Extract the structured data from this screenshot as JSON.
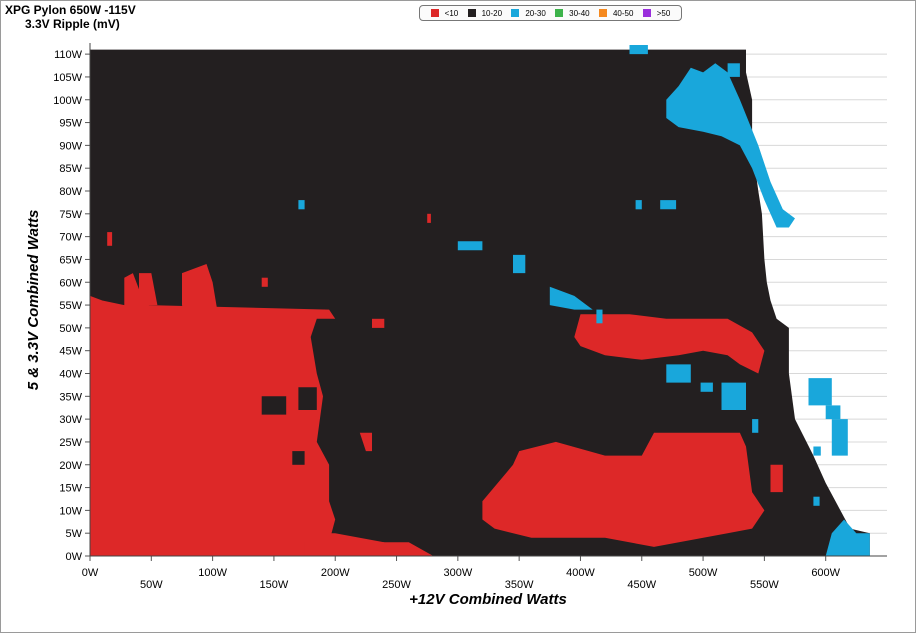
{
  "title": "XPG Pylon 650W -115V",
  "subtitle": "3.3V Ripple (mV)",
  "legend": [
    {
      "label": "<10",
      "color": "#dd2828"
    },
    {
      "label": "10-20",
      "color": "#231f20"
    },
    {
      "label": "20-30",
      "color": "#19a7db"
    },
    {
      "label": "30-40",
      "color": "#3db34a"
    },
    {
      "label": "40-50",
      "color": "#f5891f"
    },
    {
      "label": ">50",
      "color": "#9a2fdc"
    }
  ],
  "chart_data": {
    "type": "heatmap",
    "xlabel": "+12V Combined Watts",
    "ylabel": "5 & 3.3V Combined Watts",
    "x_ticks": [
      "0W",
      "50W",
      "100W",
      "150W",
      "200W",
      "250W",
      "300W",
      "350W",
      "400W",
      "450W",
      "500W",
      "550W",
      "600W"
    ],
    "y_ticks": [
      "0W",
      "5W",
      "10W",
      "15W",
      "20W",
      "25W",
      "30W",
      "35W",
      "40W",
      "45W",
      "50W",
      "55W",
      "60W",
      "65W",
      "70W",
      "75W",
      "80W",
      "85W",
      "90W",
      "95W",
      "100W",
      "105W",
      "110W"
    ],
    "xlim": [
      0,
      650
    ],
    "ylim": [
      0,
      112
    ],
    "grid": true,
    "default_band": "10-20",
    "max_x_boundary": [
      [
        0,
        636
      ],
      [
        5,
        636
      ],
      [
        6,
        620
      ],
      [
        12,
        608
      ],
      [
        16,
        600
      ],
      [
        22,
        590
      ],
      [
        30,
        575
      ],
      [
        40,
        570
      ],
      [
        50,
        570
      ],
      [
        52,
        560
      ],
      [
        56,
        555
      ],
      [
        60,
        552
      ],
      [
        65,
        550
      ],
      [
        75,
        548
      ],
      [
        80,
        545
      ],
      [
        90,
        540
      ],
      [
        100,
        540
      ],
      [
        106,
        535
      ],
      [
        111,
        535
      ]
    ],
    "regions": [
      {
        "band": "<10",
        "points": [
          [
            0,
            0
          ],
          [
            0,
            57
          ],
          [
            10,
            56
          ],
          [
            28,
            55
          ],
          [
            28,
            61
          ],
          [
            35,
            62
          ],
          [
            42,
            57
          ],
          [
            48,
            55
          ],
          [
            195,
            54
          ],
          [
            200,
            52
          ],
          [
            185,
            52
          ],
          [
            180,
            48
          ],
          [
            185,
            40
          ],
          [
            190,
            35
          ],
          [
            185,
            25
          ],
          [
            195,
            20
          ],
          [
            195,
            12
          ],
          [
            200,
            8
          ],
          [
            195,
            3
          ],
          [
            260,
            3
          ],
          [
            280,
            0
          ]
        ]
      },
      {
        "band": "<10",
        "points": [
          [
            40,
            55
          ],
          [
            40,
            62
          ],
          [
            50,
            62
          ],
          [
            55,
            55
          ]
        ]
      },
      {
        "band": "<10",
        "points": [
          [
            75,
            55
          ],
          [
            75,
            62
          ],
          [
            95,
            64
          ],
          [
            100,
            60
          ],
          [
            105,
            52
          ],
          [
            80,
            52
          ]
        ]
      },
      {
        "band": "<10",
        "points": [
          [
            175,
            5
          ],
          [
            200,
            5
          ],
          [
            240,
            3
          ],
          [
            240,
            0
          ],
          [
            175,
            0
          ]
        ]
      },
      {
        "band": "<10",
        "points": [
          [
            320,
            12
          ],
          [
            345,
            20
          ],
          [
            350,
            23
          ],
          [
            380,
            25
          ],
          [
            420,
            22
          ],
          [
            450,
            22
          ],
          [
            460,
            27
          ],
          [
            530,
            27
          ],
          [
            535,
            24
          ],
          [
            540,
            14
          ],
          [
            550,
            10
          ],
          [
            540,
            6
          ],
          [
            520,
            5
          ],
          [
            460,
            2
          ],
          [
            420,
            4
          ],
          [
            360,
            4
          ],
          [
            330,
            6
          ],
          [
            320,
            8
          ]
        ]
      },
      {
        "band": "<10",
        "points": [
          [
            395,
            48
          ],
          [
            400,
            53
          ],
          [
            440,
            53
          ],
          [
            470,
            52
          ],
          [
            520,
            52
          ],
          [
            540,
            49
          ],
          [
            550,
            45
          ],
          [
            545,
            40
          ],
          [
            530,
            42
          ],
          [
            520,
            44
          ],
          [
            500,
            45
          ],
          [
            480,
            44
          ],
          [
            450,
            43
          ],
          [
            420,
            44
          ],
          [
            400,
            46
          ]
        ]
      },
      {
        "band": "<10",
        "points": [
          [
            220,
            27
          ],
          [
            225,
            23
          ],
          [
            230,
            23
          ],
          [
            230,
            27
          ]
        ]
      },
      {
        "band": "<10",
        "points": [
          [
            230,
            52
          ],
          [
            230,
            50
          ],
          [
            240,
            50
          ],
          [
            240,
            52
          ]
        ]
      },
      {
        "band": "<10",
        "points": [
          [
            14,
            68
          ],
          [
            14,
            71
          ],
          [
            18,
            71
          ],
          [
            18,
            68
          ]
        ]
      },
      {
        "band": "<10",
        "points": [
          [
            140,
            59
          ],
          [
            140,
            61
          ],
          [
            145,
            61
          ],
          [
            145,
            59
          ]
        ]
      },
      {
        "band": "<10",
        "points": [
          [
            275,
            73
          ],
          [
            275,
            75
          ],
          [
            278,
            75
          ],
          [
            278,
            73
          ]
        ]
      },
      {
        "band": "<10",
        "points": [
          [
            555,
            14
          ],
          [
            555,
            20
          ],
          [
            565,
            20
          ],
          [
            565,
            14
          ]
        ]
      },
      {
        "band": "10-20",
        "points": [
          [
            170,
            32
          ],
          [
            170,
            37
          ],
          [
            185,
            37
          ],
          [
            185,
            32
          ]
        ]
      },
      {
        "band": "10-20",
        "points": [
          [
            140,
            31
          ],
          [
            140,
            35
          ],
          [
            160,
            35
          ],
          [
            160,
            31
          ]
        ]
      },
      {
        "band": "10-20",
        "points": [
          [
            165,
            20
          ],
          [
            165,
            23
          ],
          [
            175,
            23
          ],
          [
            175,
            20
          ]
        ]
      },
      {
        "band": "20-30",
        "points": [
          [
            470,
            100
          ],
          [
            480,
            103
          ],
          [
            490,
            107
          ],
          [
            500,
            106
          ],
          [
            510,
            108
          ],
          [
            520,
            106
          ],
          [
            530,
            100
          ],
          [
            545,
            90
          ],
          [
            555,
            82
          ],
          [
            565,
            76
          ],
          [
            575,
            74
          ],
          [
            570,
            72
          ],
          [
            560,
            72
          ],
          [
            550,
            78
          ],
          [
            540,
            85
          ],
          [
            530,
            90
          ],
          [
            515,
            92
          ],
          [
            500,
            93
          ],
          [
            480,
            94
          ],
          [
            470,
            96
          ]
        ]
      },
      {
        "band": "20-30",
        "points": [
          [
            440,
            110
          ],
          [
            440,
            112
          ],
          [
            455,
            112
          ],
          [
            455,
            110
          ]
        ]
      },
      {
        "band": "20-30",
        "points": [
          [
            520,
            105
          ],
          [
            520,
            108
          ],
          [
            530,
            108
          ],
          [
            530,
            105
          ]
        ]
      },
      {
        "band": "20-30",
        "points": [
          [
            300,
            67
          ],
          [
            300,
            69
          ],
          [
            320,
            69
          ],
          [
            320,
            67
          ]
        ]
      },
      {
        "band": "20-30",
        "points": [
          [
            345,
            62
          ],
          [
            345,
            66
          ],
          [
            355,
            66
          ],
          [
            355,
            62
          ]
        ]
      },
      {
        "band": "20-30",
        "points": [
          [
            375,
            55
          ],
          [
            375,
            59
          ],
          [
            395,
            57
          ],
          [
            410,
            54
          ],
          [
            395,
            54
          ]
        ]
      },
      {
        "band": "20-30",
        "points": [
          [
            413,
            51
          ],
          [
            413,
            54
          ],
          [
            418,
            54
          ],
          [
            418,
            51
          ]
        ]
      },
      {
        "band": "20-30",
        "points": [
          [
            470,
            38
          ],
          [
            470,
            42
          ],
          [
            490,
            42
          ],
          [
            490,
            38
          ]
        ]
      },
      {
        "band": "20-30",
        "points": [
          [
            515,
            32
          ],
          [
            515,
            38
          ],
          [
            535,
            38
          ],
          [
            535,
            32
          ]
        ]
      },
      {
        "band": "20-30",
        "points": [
          [
            498,
            36
          ],
          [
            498,
            38
          ],
          [
            508,
            38
          ],
          [
            508,
            36
          ]
        ]
      },
      {
        "band": "20-30",
        "points": [
          [
            586,
            33
          ],
          [
            586,
            39
          ],
          [
            605,
            39
          ],
          [
            605,
            33
          ]
        ]
      },
      {
        "band": "20-30",
        "points": [
          [
            600,
            30
          ],
          [
            600,
            33
          ],
          [
            612,
            33
          ],
          [
            612,
            30
          ]
        ]
      },
      {
        "band": "20-30",
        "points": [
          [
            605,
            22
          ],
          [
            605,
            30
          ],
          [
            618,
            30
          ],
          [
            618,
            22
          ]
        ]
      },
      {
        "band": "20-30",
        "points": [
          [
            590,
            22
          ],
          [
            590,
            24
          ],
          [
            596,
            24
          ],
          [
            596,
            22
          ]
        ]
      },
      {
        "band": "20-30",
        "points": [
          [
            600,
            0
          ],
          [
            605,
            5
          ],
          [
            615,
            8
          ],
          [
            625,
            5
          ],
          [
            636,
            5
          ],
          [
            636,
            0
          ]
        ]
      },
      {
        "band": "20-30",
        "points": [
          [
            170,
            76
          ],
          [
            170,
            78
          ],
          [
            175,
            78
          ],
          [
            175,
            76
          ]
        ]
      },
      {
        "band": "20-30",
        "points": [
          [
            445,
            76
          ],
          [
            445,
            78
          ],
          [
            450,
            78
          ],
          [
            450,
            76
          ]
        ]
      },
      {
        "band": "20-30",
        "points": [
          [
            465,
            76
          ],
          [
            465,
            78
          ],
          [
            478,
            78
          ],
          [
            478,
            76
          ]
        ]
      },
      {
        "band": "20-30",
        "points": [
          [
            540,
            27
          ],
          [
            540,
            30
          ],
          [
            545,
            30
          ],
          [
            545,
            27
          ]
        ]
      },
      {
        "band": "20-30",
        "points": [
          [
            590,
            11
          ],
          [
            590,
            13
          ],
          [
            595,
            13
          ],
          [
            595,
            11
          ]
        ]
      }
    ]
  }
}
